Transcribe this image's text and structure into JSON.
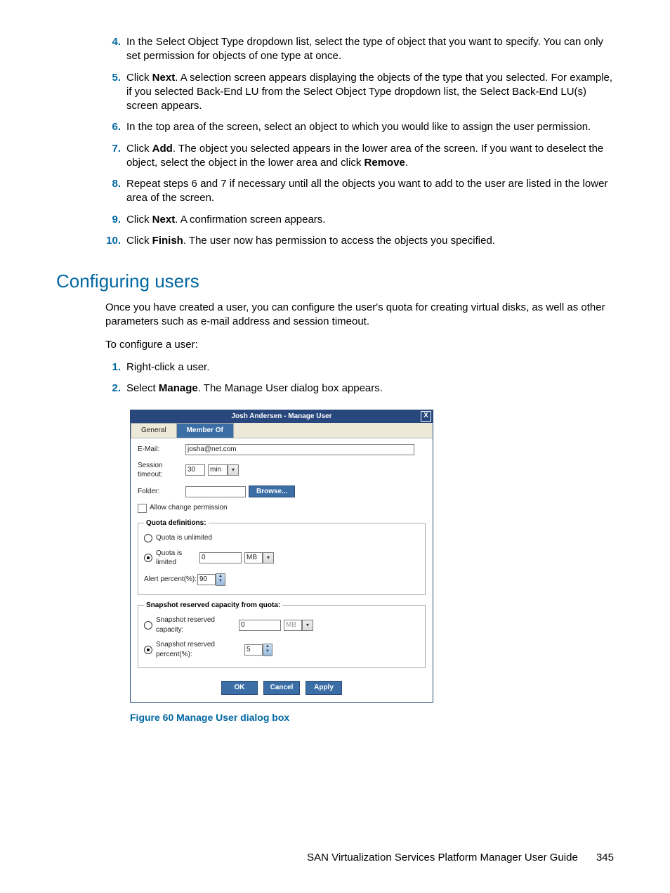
{
  "steps_top": [
    {
      "n": "4.",
      "t": "In the Select Object Type dropdown list, select the type of object that you want to specify. You can only set permission for objects of one type at once."
    },
    {
      "n": "5.",
      "pre": "Click ",
      "b": "Next",
      "post": ". A selection screen appears displaying the objects of the type that you selected. For example, if you selected Back-End LU from the Select Object Type dropdown list, the Select Back-End LU(s) screen appears."
    },
    {
      "n": "6.",
      "t": "In the top area of the screen, select an object to which you would like to assign the user permission."
    },
    {
      "n": "7.",
      "pre": "Click ",
      "b": "Add",
      "mid": ". The object you selected appears in the lower area of the screen. If you want to deselect the object, select the object in the lower area and click ",
      "b2": "Remove",
      "post": "."
    },
    {
      "n": "8.",
      "t": "Repeat steps 6 and 7 if necessary until all the objects you want to add to the user are listed in the lower area of the screen."
    },
    {
      "n": "9.",
      "pre": "Click ",
      "b": "Next",
      "post": ". A confirmation screen appears."
    },
    {
      "n": "10.",
      "pre": "Click ",
      "b": "Finish",
      "post": ". The user now has permission to access the objects you specified."
    }
  ],
  "section_heading": "Configuring users",
  "intro": "Once you have created a user, you can configure the user's quota for creating virtual disks, as well as other parameters such as e-mail address and session timeout.",
  "to_configure": "To configure a user:",
  "steps_bottom": [
    {
      "n": "1.",
      "t": "Right-click a user."
    },
    {
      "n": "2.",
      "pre": "Select ",
      "b": "Manage",
      "post": ". The Manage User dialog box appears."
    }
  ],
  "dialog": {
    "title": "Josh Andersen - Manage User",
    "close": "X",
    "tabs": [
      "General",
      "Member Of"
    ],
    "email_label": "E-Mail:",
    "email_value": "josha@net.com",
    "session_label": "Session timeout:",
    "session_value": "30",
    "session_unit": "min",
    "folder_label": "Folder:",
    "folder_value": "",
    "browse": "Browse...",
    "allow_change": "Allow change permission",
    "quota_legend": "Quota definitions:",
    "quota_unlimited": "Quota is unlimited",
    "quota_limited": "Quota is limited",
    "quota_value": "0",
    "quota_unit": "MB",
    "alert_label": "Alert percent(%):",
    "alert_value": "90",
    "snap_legend": "Snapshot reserved capacity from quota:",
    "snap_cap_label": "Snapshot reserved capacity:",
    "snap_cap_value": "0",
    "snap_cap_unit": "MB",
    "snap_pct_label": "Snapshot reserved percent(%):",
    "snap_pct_value": "5",
    "ok": "OK",
    "cancel": "Cancel",
    "apply": "Apply"
  },
  "figure_caption": "Figure 60 Manage User dialog box",
  "footer_title": "SAN Virtualization Services Platform Manager User Guide",
  "footer_page": "345"
}
